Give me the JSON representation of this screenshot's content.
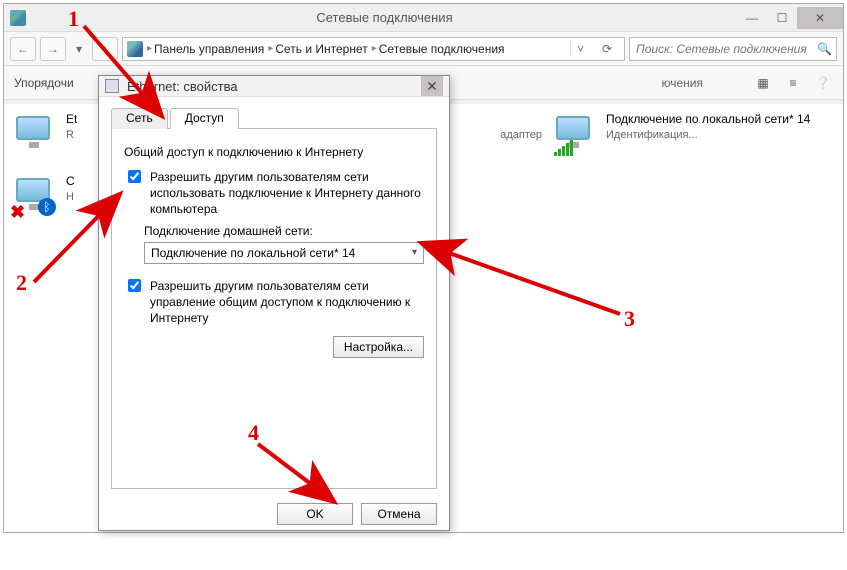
{
  "window": {
    "title": "Сетевые подключения",
    "breadcrumbs": [
      "Панель управления",
      "Сеть и Интернет",
      "Сетевые подключения"
    ],
    "search_placeholder": "Поиск: Сетевые подключения",
    "toolbar_label": "Упорядочи"
  },
  "connections": {
    "eth": {
      "name": "Et",
      "line2": "R"
    },
    "bt": {
      "name": "С",
      "line2": "Н"
    },
    "mid": {
      "line2": "адаптер"
    },
    "wifi": {
      "name": "Подключение по локальной сети* 14",
      "line2": "Идентификация..."
    },
    "right_group_label": "ючения"
  },
  "dialog": {
    "title": "Ethernet: свойства",
    "tabs": {
      "network": "Сеть",
      "access": "Доступ"
    },
    "group_title": "Общий доступ к подключению к Интернету",
    "chk1": "Разрешить другим пользователям сети использовать подключение к Интернету данного компьютера",
    "home_label": "Подключение домашней сети:",
    "home_value": "Подключение по локальной сети* 14",
    "chk2": "Разрешить другим пользователям сети управление общим доступом к подключению к Интернету",
    "settings_btn": "Настройка...",
    "ok": "OK",
    "cancel": "Отмена"
  },
  "anno": {
    "n1": "1",
    "n2": "2",
    "n3": "3",
    "n4": "4"
  }
}
